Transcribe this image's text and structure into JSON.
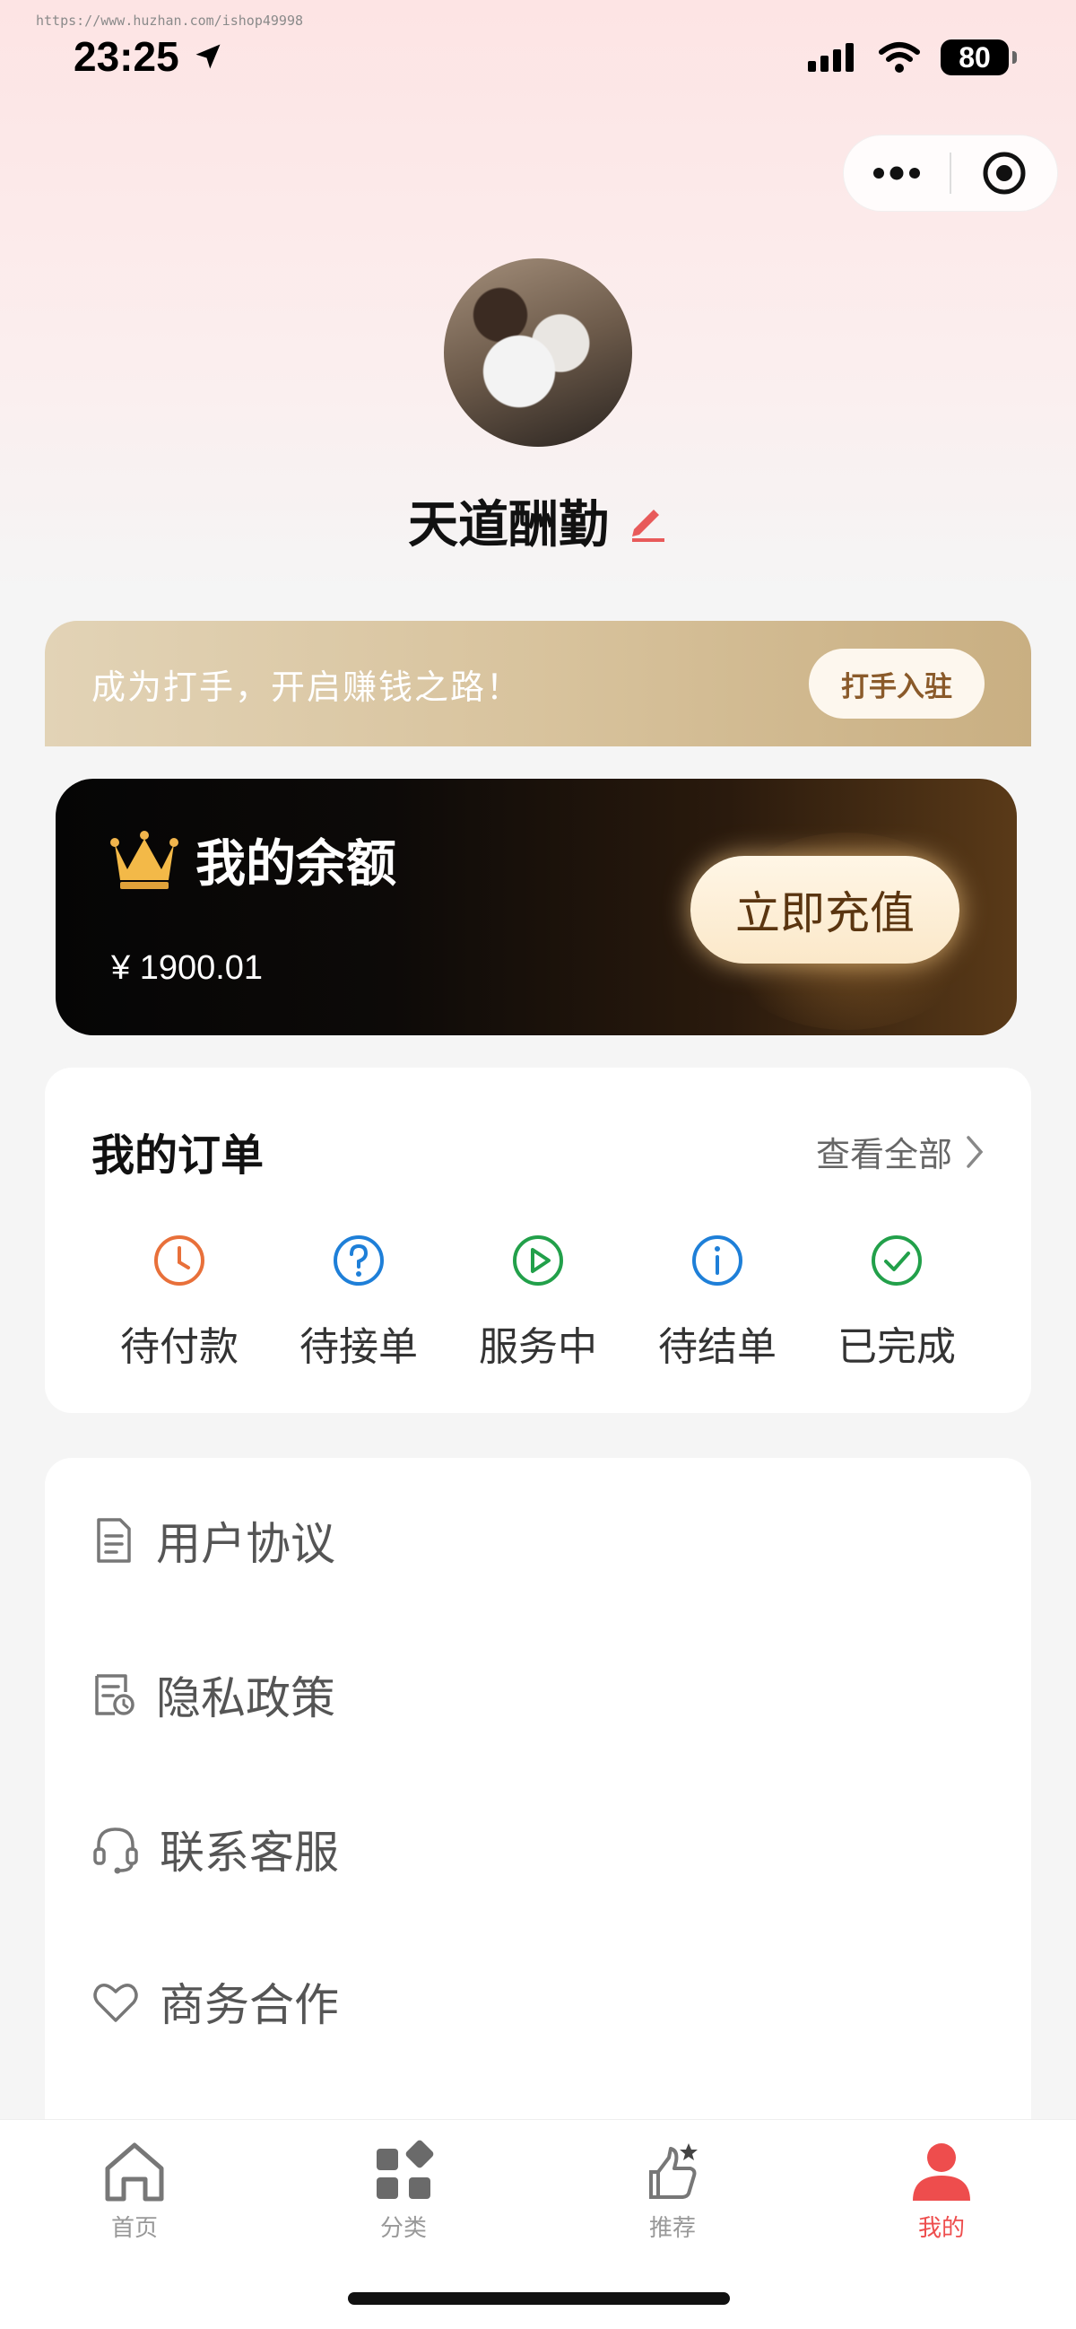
{
  "watermark": "https://www.huzhan.com/ishop49998",
  "status_bar": {
    "time": "23:25",
    "battery": "80"
  },
  "profile": {
    "name": "天道酬勤"
  },
  "banner": {
    "text": "成为打手，开启赚钱之路！",
    "button": "打手入驻"
  },
  "balance": {
    "title": "我的余额",
    "amount": "¥ 1900.01",
    "button": "立即充值"
  },
  "orders": {
    "title": "我的订单",
    "view_all": "查看全部",
    "items": [
      {
        "label": "待付款",
        "icon": "clock-icon",
        "color": "#e8703a"
      },
      {
        "label": "待接单",
        "icon": "question-icon",
        "color": "#1e7fd8"
      },
      {
        "label": "服务中",
        "icon": "play-icon",
        "color": "#22a04a"
      },
      {
        "label": "待结单",
        "icon": "info-icon",
        "color": "#1e7fd8"
      },
      {
        "label": "已完成",
        "icon": "check-icon",
        "color": "#22a04a"
      }
    ]
  },
  "menu": {
    "items": [
      {
        "label": "用户协议",
        "icon": "document-icon"
      },
      {
        "label": "隐私政策",
        "icon": "privacy-doc-icon"
      },
      {
        "label": "联系客服",
        "icon": "headset-icon"
      },
      {
        "label": "商务合作",
        "icon": "heart-icon"
      }
    ]
  },
  "tabs": [
    {
      "label": "首页",
      "icon": "home-icon"
    },
    {
      "label": "分类",
      "icon": "category-icon"
    },
    {
      "label": "推荐",
      "icon": "thumbs-up-icon"
    },
    {
      "label": "我的",
      "icon": "user-icon",
      "active": true
    }
  ],
  "colors": {
    "accent": "#ee4d4d",
    "gold": "#c9af82"
  }
}
